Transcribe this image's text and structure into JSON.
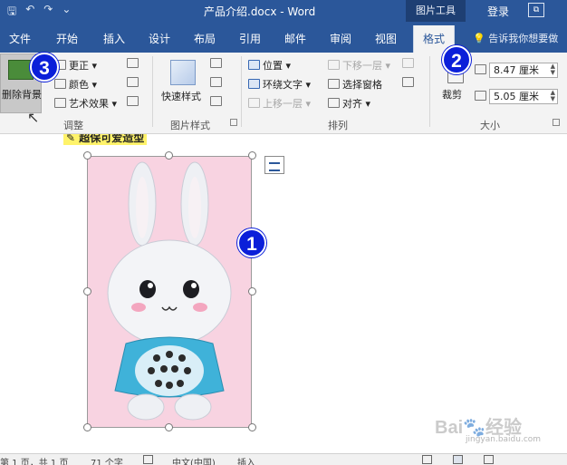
{
  "titlebar": {
    "qat_save": "🖫",
    "qat_undo": "↶",
    "qat_redo": "↷",
    "qat_more": "⌄",
    "doc_title": "产品介绍.docx - Word",
    "context_tools": "图片工具",
    "login": "登录",
    "restore": "⧉"
  },
  "tabs": [
    {
      "label": "文件"
    },
    {
      "label": "开始"
    },
    {
      "label": "插入"
    },
    {
      "label": "设计"
    },
    {
      "label": "布局"
    },
    {
      "label": "引用"
    },
    {
      "label": "邮件"
    },
    {
      "label": "审阅"
    },
    {
      "label": "视图"
    },
    {
      "label": "格式"
    }
  ],
  "tell_me": "💡 告诉我你想要做",
  "ribbon": {
    "adjust": {
      "remove_background": "删除背景",
      "corrections": "更正 ▾",
      "color": "颜色 ▾",
      "artistic_effects": "艺术效果 ▾",
      "label": "调整"
    },
    "picture_styles": {
      "quick_styles": "快速样式",
      "label": "图片样式"
    },
    "arrange": {
      "position": "位置 ▾",
      "wrap_text": "环绕文字 ▾",
      "bring_forward": "上移一层 ▾",
      "send_backward": "下移一层 ▾",
      "selection_pane": "选择窗格",
      "align": "对齐 ▾",
      "label": "排列"
    },
    "size": {
      "crop": "裁剪",
      "height": "8.47 厘米",
      "width": "5.05 厘米",
      "label": "大小"
    }
  },
  "document": {
    "heading": "✎ 超保可爱造型"
  },
  "badges": {
    "one": "1",
    "two": "2",
    "three": "3"
  },
  "statusbar": {
    "page": "第 1 页，共 1 页",
    "words": "71 个字",
    "language": "中文(中国)",
    "mode": "插入"
  },
  "watermark": {
    "text": "Bai🐾经验",
    "url": "jingyan.baidu.com"
  }
}
